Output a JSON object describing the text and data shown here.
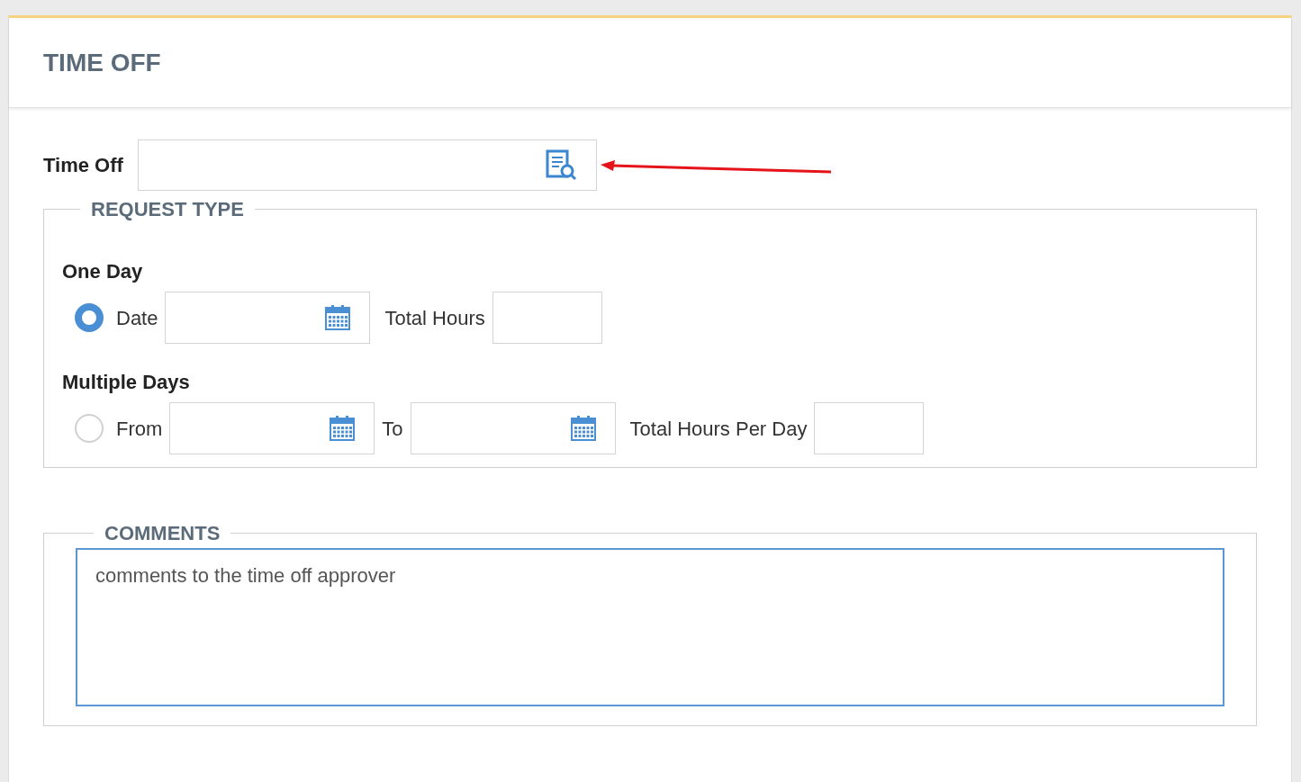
{
  "header": {
    "title": "TIME OFF"
  },
  "time_off": {
    "label": "Time Off"
  },
  "request_type": {
    "legend": "REQUEST TYPE",
    "options": [
      {
        "heading": "One Day",
        "selected": true,
        "fields": [
          {
            "kind": "date",
            "label": "Date"
          },
          {
            "kind": "text",
            "label": "Total Hours"
          }
        ]
      },
      {
        "heading": "Multiple Days",
        "selected": false,
        "fields": [
          {
            "kind": "date",
            "label": "From"
          },
          {
            "kind": "date",
            "label": "To"
          },
          {
            "kind": "text",
            "label": "Total Hours Per Day"
          }
        ]
      }
    ]
  },
  "comments": {
    "legend": "COMMENTS",
    "value": "comments to the time off approver"
  }
}
